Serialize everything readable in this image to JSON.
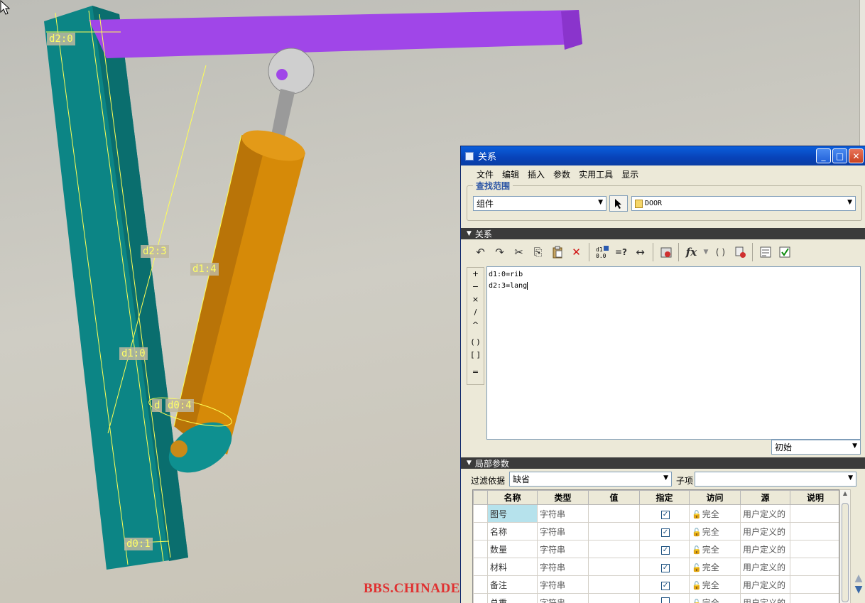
{
  "viewport": {
    "dim_labels": [
      "d2:0",
      "d2:3",
      "d1:4",
      "d1:0",
      "d",
      "d0:4",
      "d0:1"
    ],
    "watermark": "BBS.CHINADE.NET"
  },
  "dialog": {
    "title": "关系",
    "window_buttons": {
      "minimize": "_",
      "maximize": "□",
      "close": "✕"
    }
  },
  "menu": [
    "文件",
    "编辑",
    "插入",
    "参数",
    "实用工具",
    "显示"
  ],
  "search_scope": {
    "legend": "查找范围",
    "type_value": "组件",
    "model_value": "DOOR"
  },
  "relations_section": {
    "title": "关系"
  },
  "toolbar": {
    "undo": "↶",
    "redo": "↷",
    "cut": "✂",
    "copy": "⎘",
    "paste": "📋",
    "delete": "✕",
    "eval": "=?",
    "dim": "↔",
    "fx": "fx",
    "brackets": "( )"
  },
  "operators": [
    "+",
    "−",
    "×",
    "/",
    "^",
    "( )",
    "[ ]",
    "="
  ],
  "editor_lines": [
    "d1:0=rib",
    "d2:3=lang"
  ],
  "scope_combo": "初始",
  "local_params": {
    "title": "局部参数",
    "filter_label": "过滤依据",
    "filter_value": "缺省",
    "child_label": "子项",
    "child_value": "",
    "columns": [
      "名称",
      "类型",
      "值",
      "指定",
      "访问",
      "源",
      "说明"
    ],
    "rows": [
      {
        "name": "图号",
        "type": "字符串",
        "value": "",
        "designated": true,
        "access": "完全",
        "source": "用户定义的",
        "desc": ""
      },
      {
        "name": "名称",
        "type": "字符串",
        "value": "",
        "designated": true,
        "access": "完全",
        "source": "用户定义的",
        "desc": ""
      },
      {
        "name": "数量",
        "type": "字符串",
        "value": "",
        "designated": true,
        "access": "完全",
        "source": "用户定义的",
        "desc": ""
      },
      {
        "name": "材料",
        "type": "字符串",
        "value": "",
        "designated": true,
        "access": "完全",
        "source": "用户定义的",
        "desc": ""
      },
      {
        "name": "备注",
        "type": "字符串",
        "value": "",
        "designated": true,
        "access": "完全",
        "source": "用户定义的",
        "desc": ""
      },
      {
        "name": "总重",
        "type": "字符串",
        "value": "",
        "designated": false,
        "access": "完全",
        "source": "用户定义的",
        "desc": ""
      }
    ]
  },
  "colors": {
    "titlebar": "#0a4fc8",
    "teal_part": "#0e8a8a",
    "cylinder": "#d68a08",
    "beam": "#a040e6",
    "dimension": "#ffff66"
  }
}
